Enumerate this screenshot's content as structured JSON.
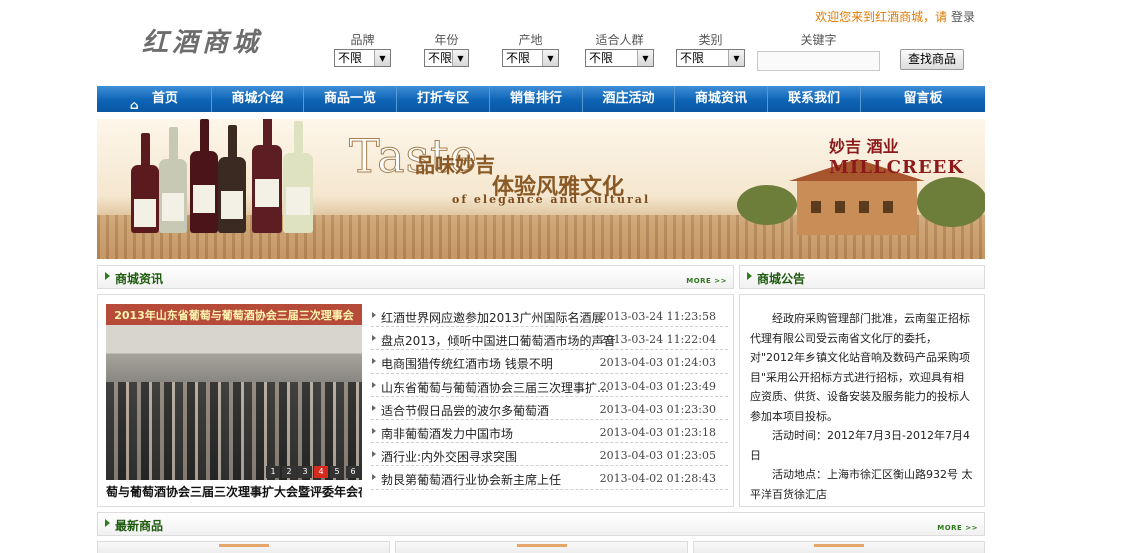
{
  "header": {
    "logo": "红酒商城",
    "welcome": "欢迎您来到红酒商城，请",
    "login": "登录"
  },
  "filters": [
    {
      "label": "品牌",
      "value": "不限"
    },
    {
      "label": "年份",
      "value": "不限"
    },
    {
      "label": "产地",
      "value": "不限"
    },
    {
      "label": "适合人群",
      "value": "不限"
    },
    {
      "label": "类别",
      "value": "不限"
    }
  ],
  "search": {
    "keyword_label": "关键字",
    "keyword_value": "",
    "button": "查找商品"
  },
  "nav": [
    "首页",
    "商城介绍",
    "商品一览",
    "打折专区",
    "销售排行",
    "酒庄活动",
    "商城资讯",
    "联系我们",
    "留言板"
  ],
  "banner": {
    "big": "Taste",
    "cn1": "品味妙吉",
    "cn2": "体验风雅文化",
    "en": "of elegance and cultural",
    "brand_cn": "妙吉 酒业",
    "brand_en": "MILLCREEK"
  },
  "news": {
    "title": "商城资讯",
    "more": "MORE >>",
    "photo_caption_top": "2013年山东省葡萄与葡萄酒协会三届三次理事会",
    "photo_caption": "萄与葡萄酒协会三届三次理事扩大会暨评委年会在",
    "pager": [
      "1",
      "2",
      "3",
      "4",
      "5",
      "6"
    ],
    "pager_active": 4,
    "items": [
      {
        "title": "红酒世界网应邀参加2013广州国际名酒展",
        "date": "2013-03-24 11:23:58"
      },
      {
        "title": "盘点2013，倾听中国进口葡萄酒市场的声音",
        "date": "2013-03-24 11:22:04"
      },
      {
        "title": "电商围猎传统红酒市场 钱景不明",
        "date": "2013-04-03 01:24:03"
      },
      {
        "title": "山东省葡萄与葡萄酒协会三届三次理事扩大会暨...",
        "date": "2013-04-03 01:23:49"
      },
      {
        "title": "适合节假日品尝的波尔多葡萄酒",
        "date": "2013-04-03 01:23:30"
      },
      {
        "title": "南非葡萄酒发力中国市场",
        "date": "2013-04-03 01:23:18"
      },
      {
        "title": "酒行业:内外交困寻求突围",
        "date": "2013-04-03 01:23:05"
      },
      {
        "title": "勃艮第葡萄酒行业协会新主席上任",
        "date": "2013-04-02 01:28:43"
      }
    ]
  },
  "notice": {
    "title": "商城公告",
    "p1": "经政府采购管理部门批准，云南玺正招标代理有限公司受云南省文化厅的委托，对\"2012年乡镇文化站音响及数码产品采购项目\"采用公开招标方式进行招标，欢迎具有相应资质、供货、设备安装及服务能力的投标人参加本项目投标。",
    "p2": "活动时间：2012年7月3日-2012年7月4日",
    "p3": "活动地点：上海市徐汇区衡山路932号 太平洋百货徐汇店"
  },
  "new_products": {
    "title": "最新商品",
    "more": "MORE >>"
  },
  "colors": {
    "nav": "#0d63b5",
    "accent": "#e07a00",
    "section": "#1e5a0e"
  }
}
